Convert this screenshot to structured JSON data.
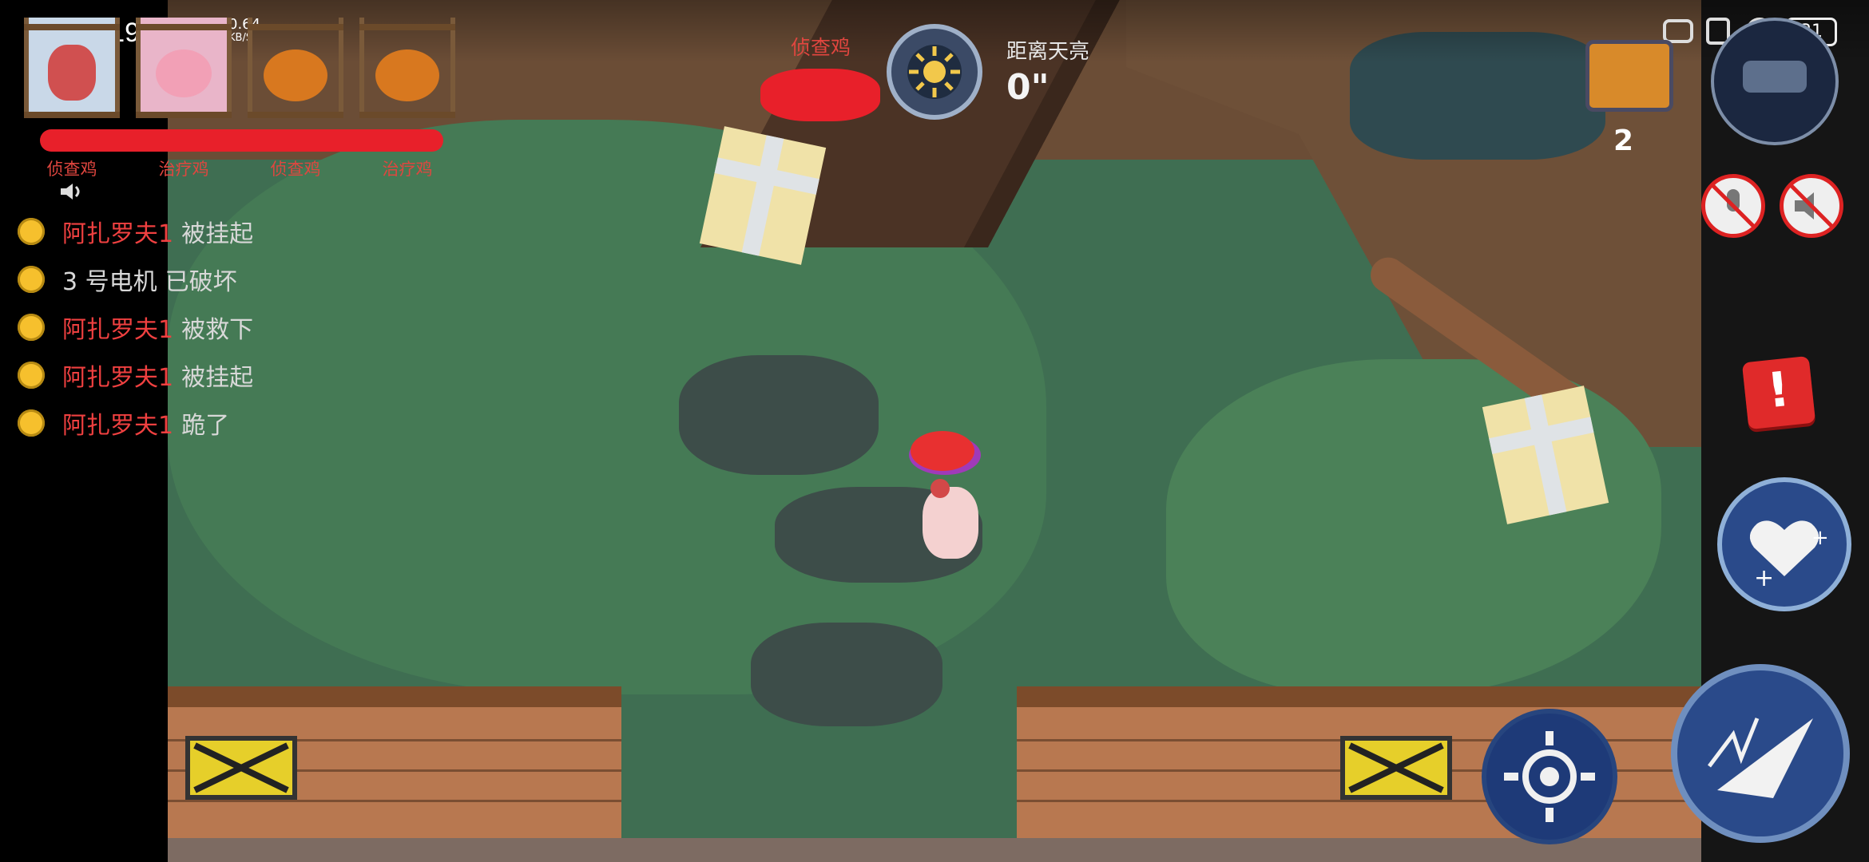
{
  "status_bar": {
    "time": "13:19",
    "network": "4G",
    "speed_value": "0.64",
    "speed_unit": "KB/S",
    "battery": "31"
  },
  "team": {
    "slots": [
      {
        "label": "侦查鸡",
        "state": "caged"
      },
      {
        "label": "治疗鸡",
        "state": "caged"
      },
      {
        "label": "侦查鸡",
        "state": "roasted"
      },
      {
        "label": "治疗鸡",
        "state": "roasted"
      }
    ]
  },
  "hud": {
    "role_label": "侦查鸡",
    "dawn_label": "距离天亮",
    "dawn_value": "0\"",
    "generator_count": "2"
  },
  "feed": [
    {
      "name": "阿扎罗夫1",
      "action": "被挂起"
    },
    {
      "name": "3 号电机",
      "action": "已破坏"
    },
    {
      "name": "阿扎罗夫1",
      "action": "被救下"
    },
    {
      "name": "阿扎罗夫1",
      "action": "被挂起"
    },
    {
      "name": "阿扎罗夫1",
      "action": "跪了"
    }
  ],
  "colors": {
    "accent_red": "#e0463f",
    "feed_dot": "#f6c02d",
    "button_blue": "#2a4a8a"
  },
  "icons": {
    "speaker": "speaker-icon",
    "mic_muted": "mic-muted-icon",
    "sound_muted": "sound-muted-icon",
    "alert": "alert-icon",
    "heal": "heal-skill-icon",
    "scan": "scan-skill-icon",
    "dash": "dash-skill-icon",
    "generator": "generator-icon",
    "camera": "camera-icon"
  }
}
